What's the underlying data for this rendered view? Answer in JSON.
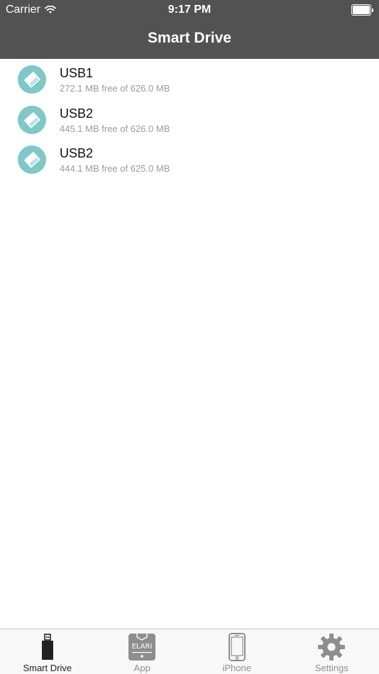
{
  "status_bar": {
    "carrier": "Carrier",
    "time": "9:17 PM"
  },
  "nav": {
    "title": "Smart Drive"
  },
  "drives": [
    {
      "name": "USB1",
      "usage": "272.1 MB free of 626.0 MB"
    },
    {
      "name": "USB2",
      "usage": "445.1 MB free of 626.0 MB"
    },
    {
      "name": "USB2",
      "usage": "444.1 MB free of 625.0 MB"
    }
  ],
  "tabs": [
    {
      "label": "Smart Drive",
      "icon": "usb-drive-icon",
      "active": true
    },
    {
      "label": "App",
      "icon": "elari-app-icon",
      "active": false
    },
    {
      "label": "iPhone",
      "icon": "iphone-icon",
      "active": false
    },
    {
      "label": "Settings",
      "icon": "gear-icon",
      "active": false
    }
  ],
  "icon_logo_text": "ELARI",
  "colors": {
    "header_bg": "#525252",
    "drive_icon": "#7ec8c8",
    "tab_active": "#222222",
    "tab_inactive": "#8e8e8e"
  }
}
